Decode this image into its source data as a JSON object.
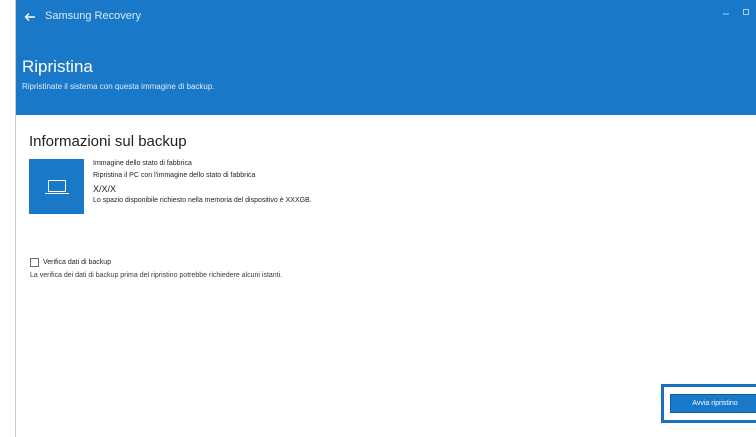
{
  "window": {
    "app_title": "Samsung Recovery",
    "back_icon": "arrow-left-icon",
    "minimize_icon": "minimize-icon",
    "maximize_icon": "maximize-icon"
  },
  "header": {
    "title": "Ripristina",
    "subtitle": "Ripristinate il sistema con questa immagine di backup.",
    "accent_color": "#1a78c8"
  },
  "backup_info": {
    "section_title": "Informazioni sul backup",
    "icon": "laptop-icon",
    "image_name": "Immagine dello stato di fabbrica",
    "description": "Ripristina il PC con l'immagine dello stato di fabbrica",
    "version": "X/X/X",
    "space_note": "Lo spazio disponibile richiesto nella memoria del dispositivo è XXXGB."
  },
  "verify": {
    "label": "Verifica dati di backup",
    "description": "La verifica dei dati di backup prima del ripristino potrebbe richiedere alcuni istanti.",
    "checked": false
  },
  "actions": {
    "start_label": "Avvia ripristino"
  }
}
